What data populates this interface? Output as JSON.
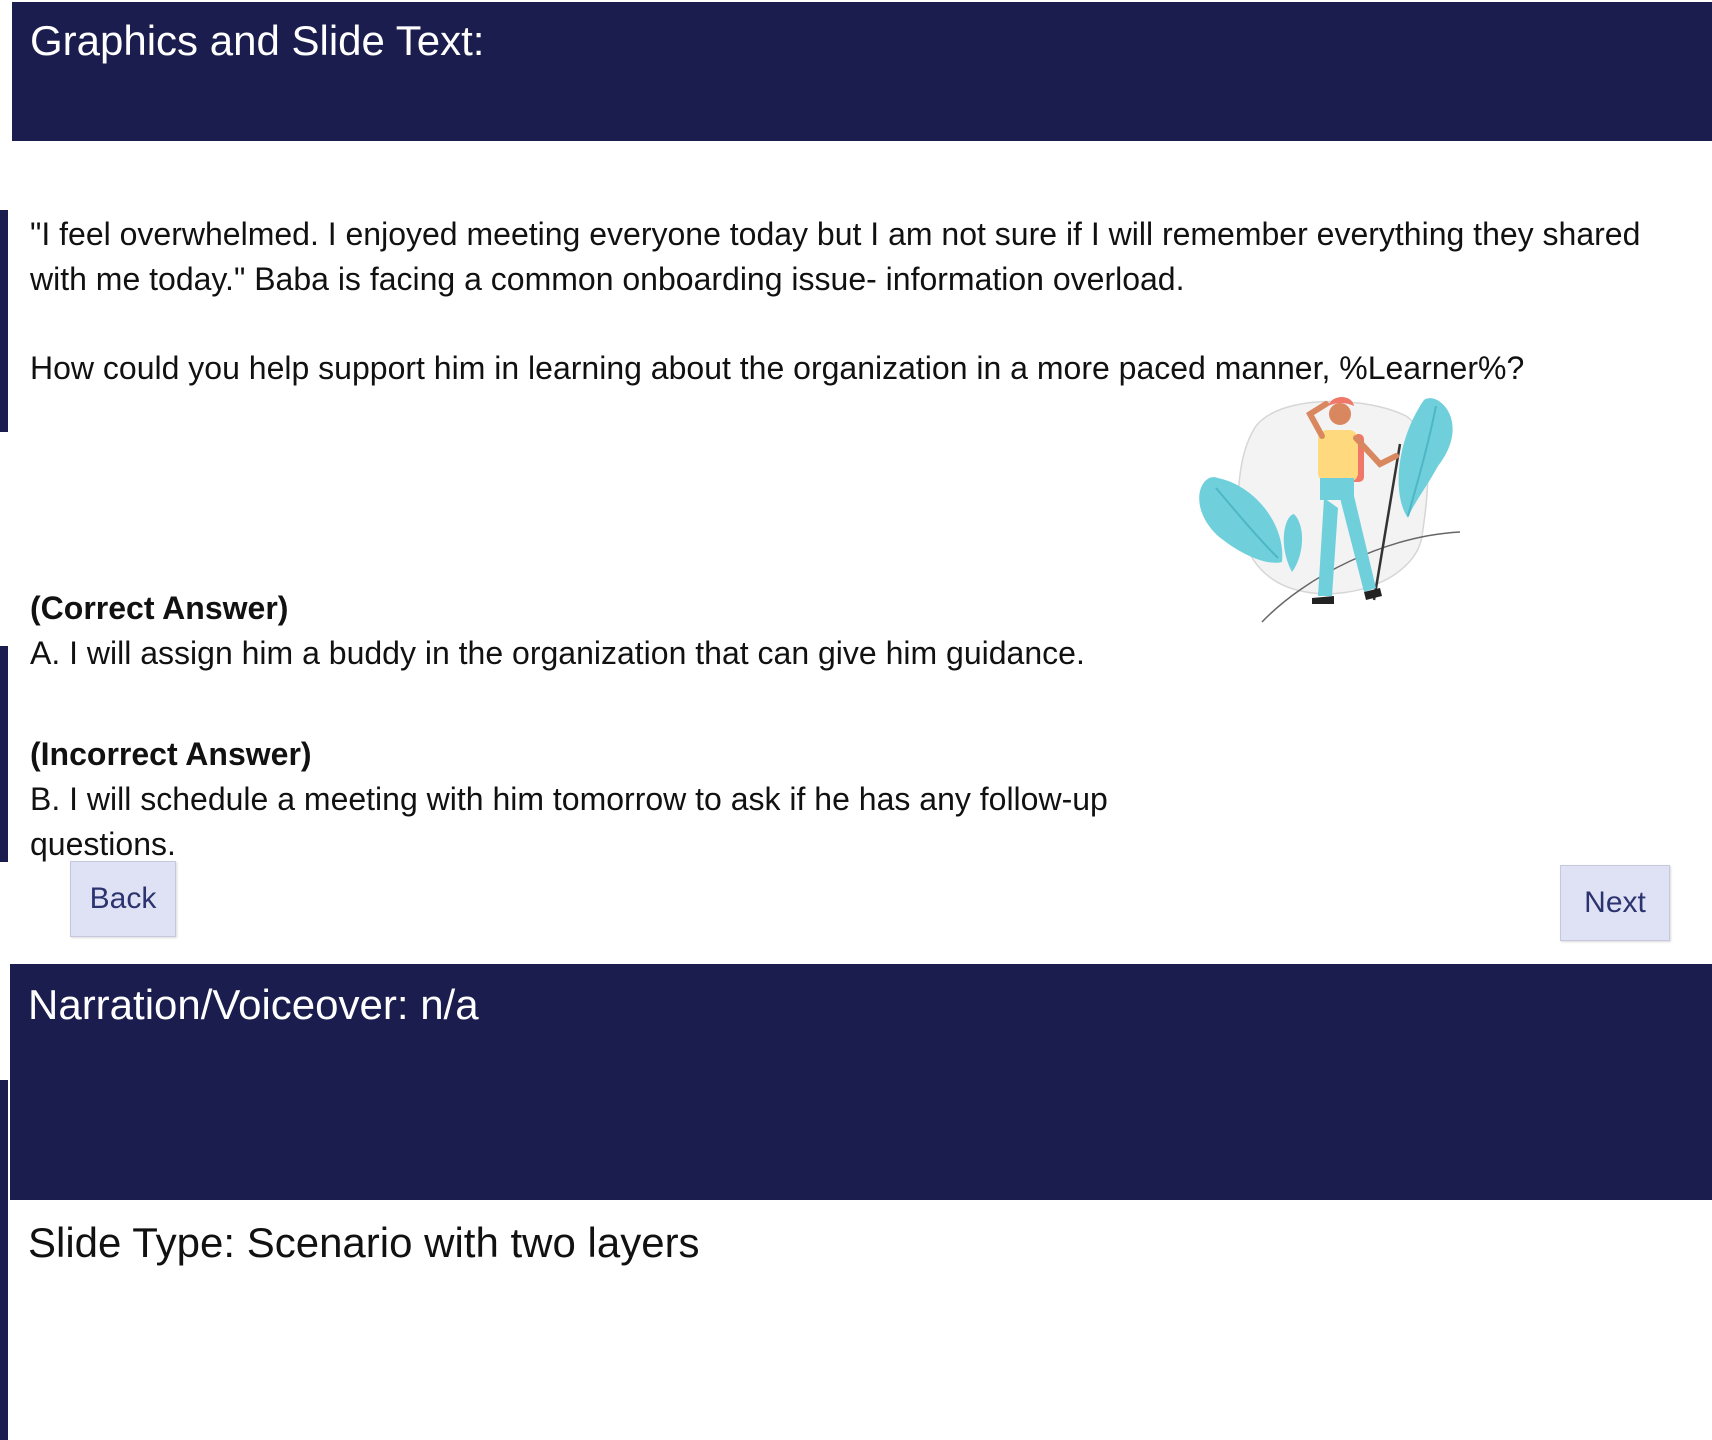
{
  "header": {
    "title": "Graphics and Slide Text:"
  },
  "scenario": {
    "quote": "\"I feel overwhelmed. I enjoyed meeting everyone today but I am not sure if I will remember everything they shared with me today.\" Baba is facing a common onboarding issue- information overload.",
    "question": "How could you help support him in learning about the organization in a more paced manner, %Learner%?"
  },
  "answers": {
    "correct_label": "(Correct Answer)",
    "correct_text": "A. I will assign him a buddy in the organization that can give him guidance.",
    "incorrect_label": "(Incorrect Answer)",
    "incorrect_text": "B. I will schedule a meeting with him tomorrow to ask if he has any follow-up questions."
  },
  "nav": {
    "back_label": "Back",
    "next_label": "Next"
  },
  "narration": {
    "title": "Narration/Voiceover: n/a"
  },
  "slide_type": {
    "text": "Slide Type: Scenario with two layers"
  },
  "colors": {
    "band": "#1a1d4d",
    "button_bg": "#dfe1f4",
    "button_text": "#2c3470",
    "leaf": "#6fd0dc"
  },
  "illustration": {
    "icon": "hiker-with-walking-stick-icon"
  }
}
